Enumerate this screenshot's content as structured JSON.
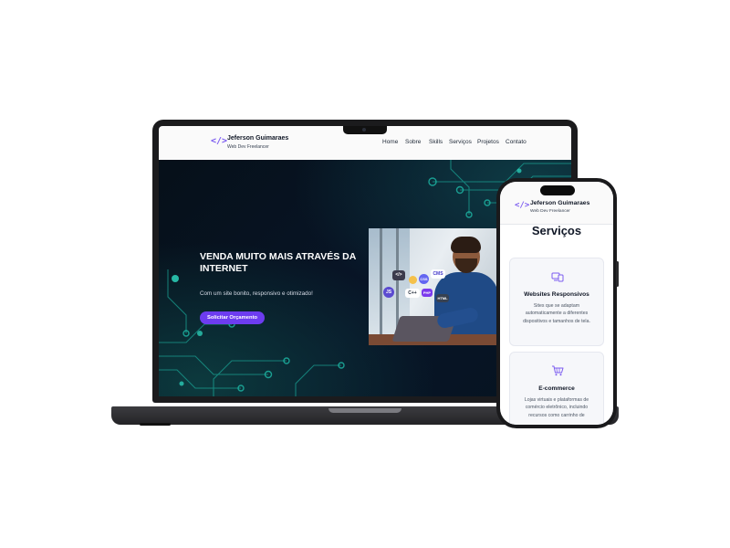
{
  "site": {
    "brand": {
      "name": "Jeferson Guimaraes",
      "subtitle": "Web Dev Freelancer",
      "logo_glyph": "</>"
    },
    "nav": [
      {
        "label": "Home"
      },
      {
        "label": "Sobre"
      },
      {
        "label": "Skills"
      },
      {
        "label": "Serviços"
      },
      {
        "label": "Projetos"
      },
      {
        "label": "Contato"
      }
    ],
    "hero": {
      "title": "VENDA MUITO MAIS ATRAVÉS DA INTERNET",
      "subtitle": "Com um site bonito, responsivo e otimizado!",
      "cta": "Solicitar Orçamento",
      "tech_badges": [
        "</>",
        "JS",
        "C++",
        "CSS",
        "CMS",
        "PHP",
        "HTML"
      ]
    }
  },
  "mobile": {
    "brand": {
      "name": "Jeferson Guimaraes",
      "subtitle": "Web Dev Freelancer",
      "logo_glyph": "</>"
    },
    "section_title": "Serviços",
    "services": [
      {
        "icon": "devices-icon",
        "title": "Websites Responsivos",
        "desc_lines": [
          "Sites que se adaptam",
          "automaticamente a diferentes",
          "dispositivos e tamanhos de tela."
        ]
      },
      {
        "icon": "shopping-cart-icon",
        "title": "E-commerce",
        "desc_lines": [
          "Lojas virtuais e plataformas de",
          "comércio eletrônico, incluindo",
          "recursos como carrinho de"
        ]
      }
    ]
  },
  "colors": {
    "accent": "#7c5cf0",
    "cta": "#6d3cf0",
    "hero_bg": "#070d18",
    "circuit": "#1fc5b0",
    "nav_bg": "#fafafa"
  }
}
